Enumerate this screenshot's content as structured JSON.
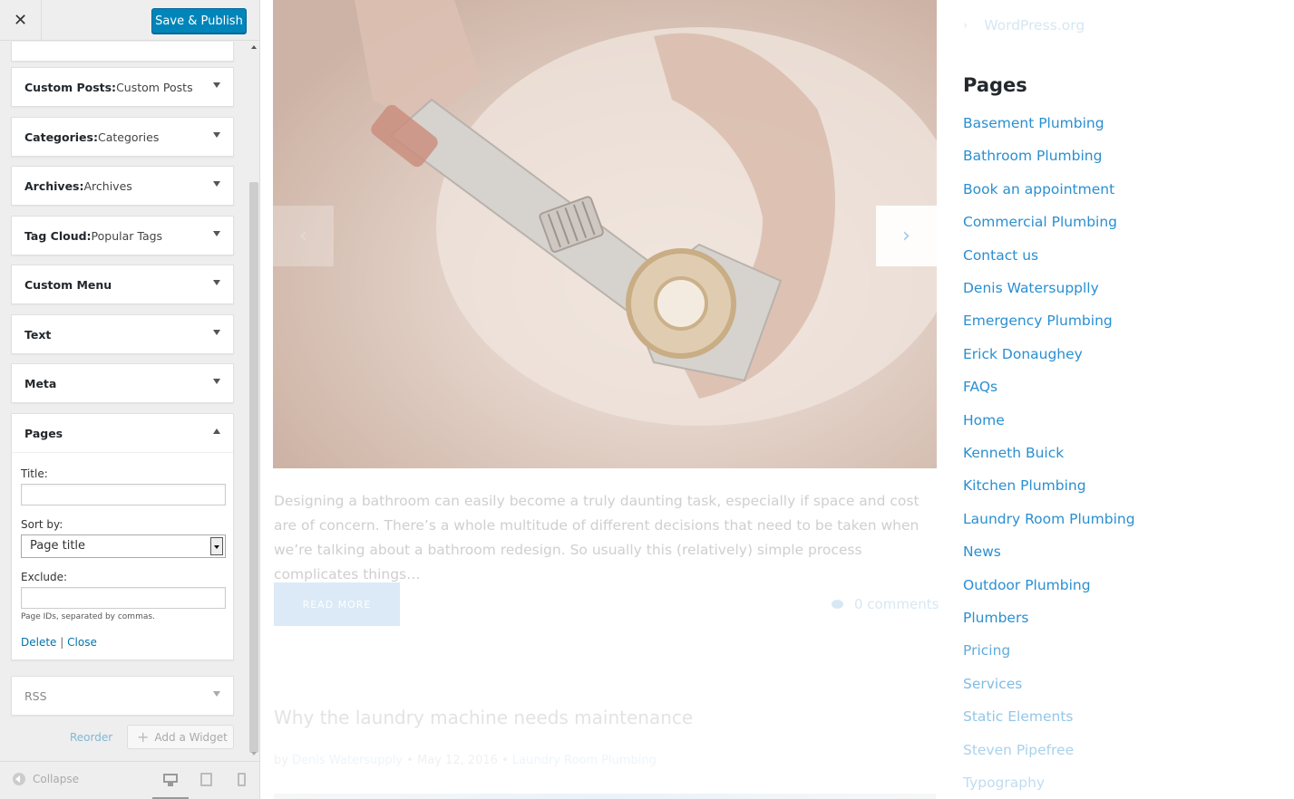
{
  "customizer": {
    "close_icon": "close-icon",
    "close_glyph": "✕",
    "save_label": "Save & Publish",
    "widgets": [
      {
        "title": "Custom Posts:",
        "subtitle": " Custom Posts"
      },
      {
        "title": "Categories:",
        "subtitle": " Categories"
      },
      {
        "title": "Archives:",
        "subtitle": " Archives"
      },
      {
        "title": "Tag Cloud:",
        "subtitle": " Popular Tags"
      },
      {
        "title": "Custom Menu",
        "subtitle": ""
      },
      {
        "title": "Text",
        "subtitle": ""
      },
      {
        "title": "Meta",
        "subtitle": ""
      },
      {
        "title": "Pages",
        "subtitle": ""
      },
      {
        "title": "RSS",
        "subtitle": ""
      }
    ],
    "pages_form": {
      "title_label": "Title:",
      "title_value": "",
      "sort_label": "Sort by:",
      "sort_value": "Page title",
      "exclude_label": "Exclude:",
      "exclude_value": "",
      "exclude_hint": "Page IDs, separated by commas.",
      "delete_label": "Delete",
      "separator": "|",
      "close_label": "Close"
    },
    "reorder_label": "Reorder",
    "add_widget_label": "Add a Widget",
    "add_widget_glyph": "+",
    "collapse_label": "Collapse"
  },
  "preview": {
    "excerpt": "Designing a bathroom can easily become a truly daunting task, especially if space and cost are of concern. There’s a whole multitude of different decisions that need to be taken when we’re talking about a bathroom redesign. So usually this (relatively) simple process complicates things…",
    "read_more": "READ MORE",
    "comments": "0 comments",
    "prev_glyph": "‹",
    "next_glyph": "›",
    "post_title": "Why the laundry machine needs maintenance",
    "post_meta_by": "by",
    "post_meta_author": "Denis Watersupply",
    "post_meta_date": "• May 12, 2016 •",
    "post_meta_category": "Laundry Room Plumbing",
    "wp_chevron": "›",
    "wp_org": "WordPress.org",
    "pages_heading": "Pages",
    "pages": [
      "Basement Plumbing",
      "Bathroom Plumbing",
      "Book an appointment",
      "Commercial Plumbing",
      "Contact us",
      "Denis Watersupplly",
      "Emergency Plumbing",
      "Erick Donaughey",
      "FAQs",
      "Home",
      "Kenneth Buick",
      "Kitchen Plumbing",
      "Laundry Room Plumbing",
      "News",
      "Outdoor Plumbing",
      "Plumbers",
      "Pricing",
      "Services",
      "Static Elements",
      "Steven Pipefree",
      "Typography"
    ],
    "page_link_opacities": [
      1,
      1,
      1,
      1,
      1,
      1,
      1,
      1,
      1,
      1,
      1,
      1,
      1,
      1,
      1,
      1,
      0.75,
      0.6,
      0.5,
      0.4,
      0.3
    ]
  },
  "colors": {
    "accent": "#0085ba",
    "link": "#2a8fd1",
    "sidebar_bg": "#eeeeee"
  }
}
